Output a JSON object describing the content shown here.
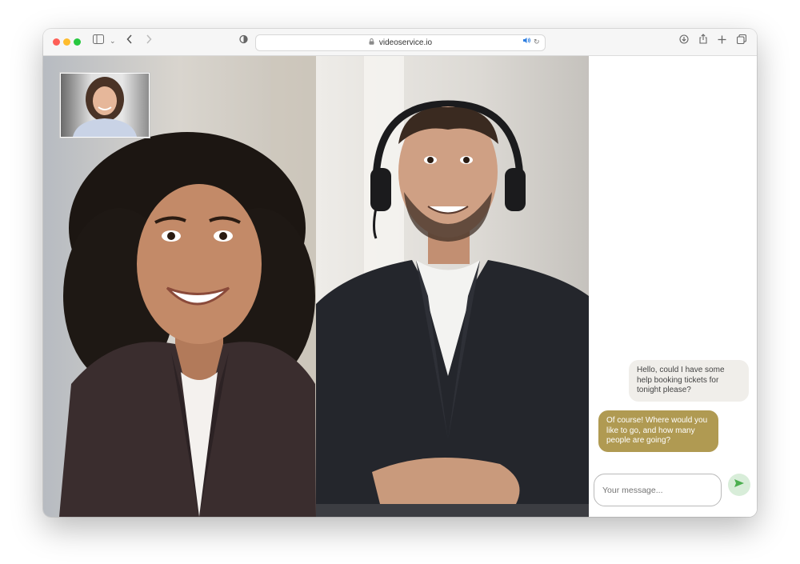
{
  "browser": {
    "url": "videoservice.io",
    "icons": {
      "sidebar": "sidebar-icon",
      "back": "chevron-left-icon",
      "forward": "chevron-right-icon",
      "shield": "shield-icon",
      "lock": "lock-icon",
      "audio": "speaker-icon",
      "reload": "reload-icon",
      "download": "download-icon",
      "share": "share-icon",
      "new_tab": "plus-icon",
      "tabs": "tabs-icon"
    }
  },
  "chat": {
    "messages": [
      {
        "direction": "incoming",
        "text": "Hello, could I have some help booking tickets for tonight please?"
      },
      {
        "direction": "outgoing",
        "text": "Of course! Where would you like to go, and how many people are going?"
      }
    ],
    "input_placeholder": "Your message...",
    "send_icon": "send-icon"
  },
  "colors": {
    "outgoing_bubble": "#b09a52",
    "incoming_bubble": "#f0eeea",
    "send_button": "#d8edd9",
    "send_arrow": "#4caf50"
  }
}
